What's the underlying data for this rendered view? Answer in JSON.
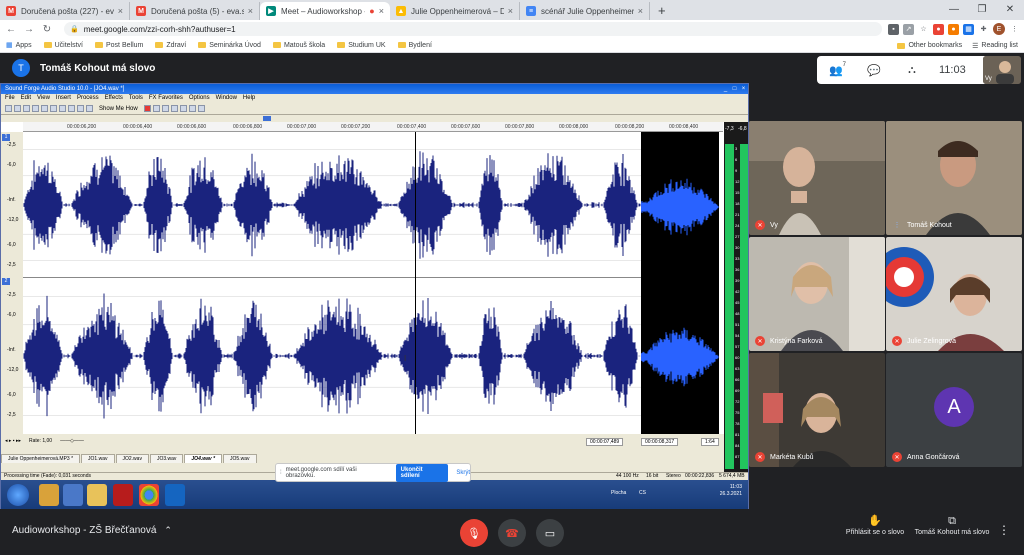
{
  "browser": {
    "tabs": [
      {
        "label": "Doručená pošta (227) - evasmolik",
        "icon": "gmail-icon",
        "color": "#ea4335",
        "glyph": "M"
      },
      {
        "label": "Doručená pošta (5) - eva.smolik",
        "icon": "gmail-icon",
        "color": "#ea4335",
        "glyph": "M"
      },
      {
        "label": "Meet – Audioworkshop - ZŠ",
        "icon": "meet-icon",
        "color": "#00897b",
        "glyph": "▶",
        "active": true
      },
      {
        "label": "Julie Oppenheimerová – Disk Go",
        "icon": "drive-icon",
        "color": "#fbbc04",
        "glyph": "▲"
      },
      {
        "label": "scénář Julie Oppenheimerová fin",
        "icon": "docs-icon",
        "color": "#4285f4",
        "glyph": "≡"
      }
    ],
    "new_tab": "+",
    "url": "meet.google.com/zzi-corh-shh?authuser=1",
    "profile_initial": "E",
    "bookmarks": [
      "Apps",
      "Učitelství",
      "Post Bellum",
      "Zdraví",
      "Seminárka Úvod",
      "Matouš škola",
      "Studium UK",
      "Bydlení"
    ],
    "other_bookmarks": "Other bookmarks",
    "reading_list": "Reading list"
  },
  "meet": {
    "presenter_initial": "T",
    "presenter_label": "Tomáš Kohout má slovo",
    "participant_count": "7",
    "clock": "11:03",
    "self_label": "Vy",
    "share_notice": "meet.google.com sdílí vaši obrazovku.",
    "stop_sharing": "Ukončit sdílení",
    "hide": "Skrýt",
    "meeting_name": "Audioworkshop - ZŠ Břečťanová",
    "raise_hand": "Přihlásit se o slovo",
    "presenting": "Tomáš Kohout má slovo",
    "tiles": [
      {
        "name": "Vy",
        "muted": true
      },
      {
        "name": "Tomáš Kohout",
        "muted": false
      },
      {
        "name": "Kristýna Farková",
        "muted": true
      },
      {
        "name": "Julie Zelingrová",
        "muted": true
      },
      {
        "name": "Markéta Kubů",
        "muted": true
      },
      {
        "name": "Anna Gončárová",
        "muted": true,
        "initial": "A"
      }
    ]
  },
  "soundforge": {
    "title": "Sound Forge Audio Studio 10.0 - [JO4.wav *]",
    "menu": [
      "File",
      "Edit",
      "View",
      "Insert",
      "Process",
      "Effects",
      "Tools",
      "FX Favorites",
      "Options",
      "Window",
      "Help"
    ],
    "show_me_how": "Show Me How",
    "ruler": [
      "00:00:06,200",
      "00:00:06,400",
      "00:00:06,600",
      "00:00:06,800",
      "00:00:07,000",
      "00:00:07,200",
      "00:00:07,400",
      "00:00:07,600",
      "00:00:07,800",
      "00:00:08,000",
      "00:00:08,200",
      "00:00:08,400"
    ],
    "db_scale": [
      "-2,5",
      "-6,0",
      "-Inf.",
      "-12,0",
      "-6,0",
      "-2,5"
    ],
    "meter_labels": [
      "-7,3",
      "-6,8"
    ],
    "meter_scale": [
      "3",
      "6",
      "9",
      "12",
      "15",
      "18",
      "21",
      "24",
      "27",
      "30",
      "33",
      "36",
      "39",
      "42",
      "45",
      "48",
      "51",
      "54",
      "57",
      "60",
      "63",
      "66",
      "69",
      "72",
      "75",
      "78",
      "81",
      "84",
      "87"
    ],
    "rate": "Rate: 1,00",
    "doc_tabs": [
      "Julie Oppenheimerová.MP3 *",
      "JO1.wav",
      "JO2.wav",
      "JO3.wav",
      "JO4.wav *",
      "JO5.wav"
    ],
    "times": [
      "00:00:07,489",
      "00:00:08,317",
      "1:64"
    ],
    "status_left": "Processing time (Fade): 0,031 seconds",
    "status_right": [
      "44 100 Hz",
      "16 bit",
      "Stereo",
      "00:00:22,836",
      "5 674,4 MB"
    ],
    "tray_lang": "CS",
    "tray_time": "11:03",
    "tray_date": "26.3.2021",
    "tray_desktop": "Plocha"
  }
}
